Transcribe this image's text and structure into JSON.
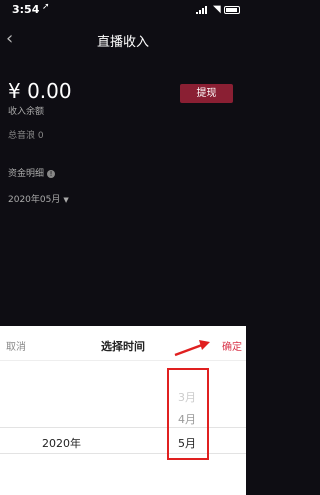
{
  "status_bar": {
    "time": "3:54",
    "location_icon": "location-arrow-icon"
  },
  "header": {
    "back_icon": "chevron-left-icon",
    "title": "直播收入"
  },
  "balance": {
    "amount": "¥ 0.00",
    "label": "收入余额",
    "withdraw_label": "提现"
  },
  "total": "总音浪 0",
  "detail": {
    "label": "资金明细",
    "info_icon": "info-icon"
  },
  "month_filter": {
    "value": "2020年05月",
    "caret_icon": "caret-down-icon"
  },
  "picker": {
    "cancel": "取消",
    "title": "选择时间",
    "confirm": "确定",
    "year": "2020年",
    "months": [
      "3月",
      "4月",
      "5月"
    ],
    "selected_month": "5月"
  },
  "colors": {
    "accent": "#d9354a",
    "annotation": "#e02020",
    "withdraw_bg": "#8a1f33",
    "background": "#0e0d13"
  }
}
